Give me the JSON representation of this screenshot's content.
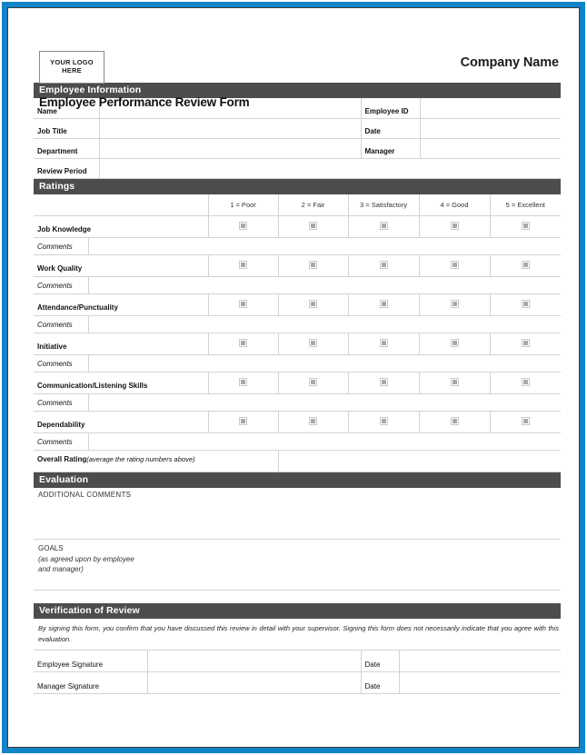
{
  "document": {
    "logo_line1": "YOUR LOGO",
    "logo_line2": "HERE",
    "company_name": "Company Name",
    "title": "Employee Performance Review Form"
  },
  "employee_information": {
    "section_title": "Employee Information",
    "rows": [
      {
        "left_label": "Name",
        "left_value": "",
        "right_label": "Employee ID",
        "right_value": ""
      },
      {
        "left_label": "Job Title",
        "left_value": "",
        "right_label": "Date",
        "right_value": ""
      },
      {
        "left_label": "Department",
        "left_value": "",
        "right_label": "Manager",
        "right_value": ""
      },
      {
        "left_label": "Review Period",
        "left_value": "",
        "right_label": "",
        "right_value": ""
      }
    ]
  },
  "ratings": {
    "section_title": "Ratings",
    "scale": [
      "1 = Poor",
      "2 = Fair",
      "3 = Satisfactory",
      "4 = Good",
      "5 = Excellent"
    ],
    "comment_label": "Comments",
    "criteria": [
      {
        "label": "Job Knowledge",
        "comment_value": "",
        "selected": null
      },
      {
        "label": "Work Quality",
        "comment_value": "",
        "selected": null
      },
      {
        "label": "Attendance/Punctuality",
        "comment_value": "",
        "selected": null
      },
      {
        "label": "Initiative",
        "comment_value": "",
        "selected": null
      },
      {
        "label": "Communication/Listening  Skills",
        "comment_value": "",
        "selected": null
      },
      {
        "label": "Dependability",
        "comment_value": "",
        "selected": null
      }
    ],
    "overall": {
      "label_bold": "Overall  Rating",
      "label_italic": "(average  the  rating  numbers  above)",
      "value": ""
    }
  },
  "evaluation": {
    "section_title": "Evaluation",
    "additional_comments_label": "ADDITIONAL  COMMENTS",
    "additional_comments_value": "",
    "goals_label": "GOALS",
    "goals_note_line1": "(as agreed  upon  by employee",
    "goals_note_line2": "and manager)",
    "goals_value": ""
  },
  "verification": {
    "section_title": "Verification  of Review",
    "statement": "By signing  this form, you confirm  that you have discussed this review in detail  with your supervisor.  Signing  this form does not necessarily  indicate  that you agree  with this evaluation.",
    "rows": [
      {
        "label": "Employee Signature",
        "signature": "",
        "date_label": "Date",
        "date_value": ""
      },
      {
        "label": "Manager  Signature",
        "signature": "",
        "date_label": "Date",
        "date_value": ""
      }
    ]
  },
  "colors": {
    "section_bar": "#4d4d4d",
    "frame_blue": "#1184c8",
    "frame_dark": "#3a3a3a",
    "rule": "#d3d3d3",
    "checkbox": "#a9a9a9"
  }
}
